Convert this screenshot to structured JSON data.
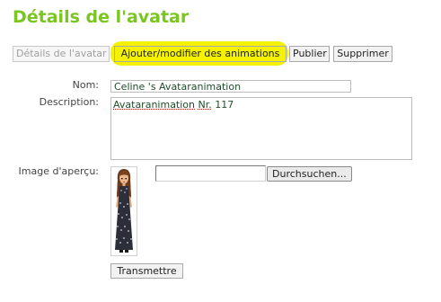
{
  "colors": {
    "title": "#7ac51f",
    "input_text": "#1f4d29",
    "highlighter": "#f4f200",
    "label_text": "#444444"
  },
  "page": {
    "title": "Détails de l'avatar"
  },
  "toolbar": {
    "details_label": "Détails de l'avatar",
    "animations_label": "Ajouter/modifier des animations",
    "publish_label": "Publier",
    "delete_label": "Supprimer"
  },
  "form": {
    "name_label": "Nom:",
    "name_value": "Celine 's Avataranimation",
    "description_label": "Description:",
    "description_word1": "Avataranimation",
    "description_word2": "Nr.",
    "description_word3": "117",
    "preview_label": "Image d'aperçu:",
    "file_value": "",
    "browse_label": "Durchsuchen...",
    "submit_label": "Transmettre"
  },
  "icons": {
    "preview": "avatar-figure-icon"
  }
}
